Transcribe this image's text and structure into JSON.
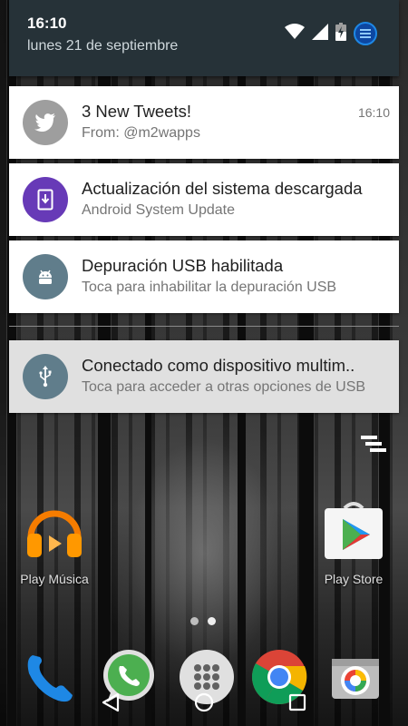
{
  "quick_settings": {
    "time": "16:10",
    "date": "lunes 21 de septiembre",
    "status_icons": [
      "wifi-icon",
      "signal-icon",
      "battery-charging-icon",
      "user-avatar-icon"
    ]
  },
  "notifications": [
    {
      "icon": "twitter-bird-icon",
      "icon_color": "#9e9e9e",
      "title": "3 New Tweets!",
      "subtitle": "From: @m2wapps",
      "time": "16:10"
    },
    {
      "icon": "system-update-icon",
      "icon_color": "#673ab7",
      "title": "Actualización del sistema descargada",
      "subtitle": "Android System Update"
    },
    {
      "icon": "android-icon",
      "icon_color": "#607d8b",
      "title": "Depuración USB habilitada",
      "subtitle": "Toca para inhabilitar la depuración USB"
    },
    {
      "icon": "usb-icon",
      "icon_color": "#607d8b",
      "title": "Conectado como dispositivo multim..",
      "subtitle": "Toca para acceder a otras opciones de USB"
    }
  ],
  "home_apps": [
    {
      "label": "Play Música",
      "icon": "headphones-icon"
    },
    {
      "label": "Play Store",
      "icon": "play-store-icon"
    }
  ],
  "dock_apps": [
    "phone-icon",
    "whatsapp-icon",
    "app-drawer-icon",
    "chrome-icon",
    "camera-icon"
  ],
  "nav_buttons": [
    "back-icon",
    "home-icon",
    "recents-icon"
  ],
  "colors": {
    "header_bg": "#263238",
    "card_bg": "#ffffff",
    "selected_card_bg": "#e0e0e0"
  }
}
